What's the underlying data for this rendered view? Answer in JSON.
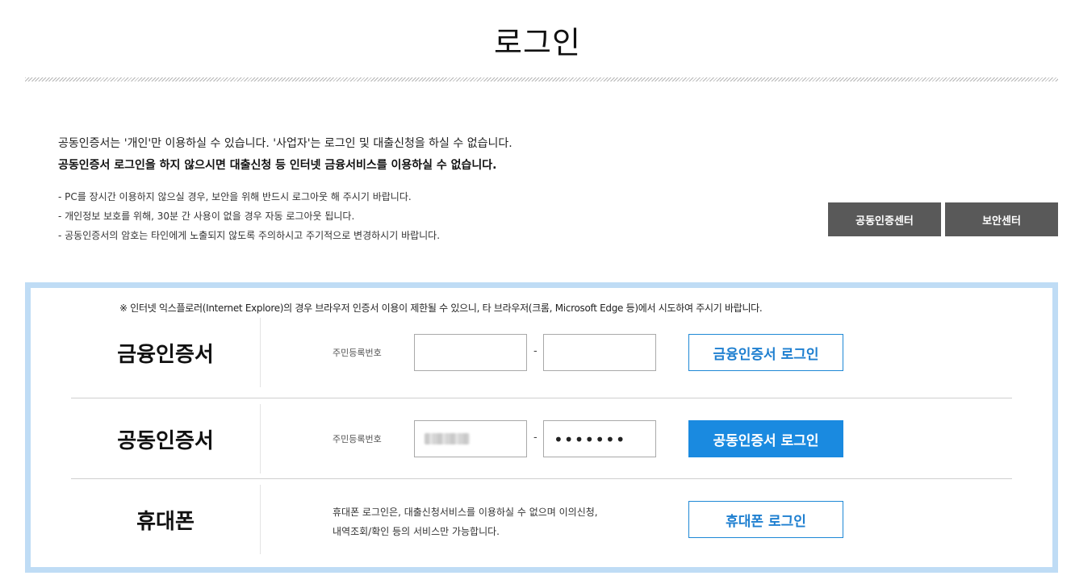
{
  "page": {
    "title": "로그인"
  },
  "notice": {
    "main": "공동인증서는 '개인'만 이용하실 수 있습니다. '사업자'는 로그인 및 대출신청을 하실 수 없습니다.",
    "bold": "공동인증서 로그인을 하지 않으시면 대출신청 등 인터넷 금융서비스를 이용하실 수 없습니다.",
    "items": [
      "- PC를 장시간 이용하지 않으실 경우, 보안을 위해 반드시 로그아웃 해 주시기 바랍니다.",
      "- 개인정보 보호를 위해, 30분 간 사용이 없을 경우 자동 로그아웃 됩니다.",
      "- 공동인증서의 암호는 타인에게 노출되지 않도록 주의하시고 주기적으로 변경하시기 바랍니다."
    ]
  },
  "buttons": {
    "cert_center": "공동인증센터",
    "security_center": "보안센터"
  },
  "login_box": {
    "ie_notice": "※ 인터넷 익스플로러(Internet Explore)의 경우 브라우저 인증서 이용이 제한될 수 있으니, 타 브라우저(크롬, Microsoft Edge 등)에서 시도하여 주시기 바랍니다.",
    "financial": {
      "label": "금융인증서",
      "field_label": "주민등록번호",
      "separator": "-",
      "front_value": "",
      "back_value": "",
      "button": "금융인증서 로그인"
    },
    "joint": {
      "label": "공동인증서",
      "field_label": "주민등록번호",
      "separator": "-",
      "back_value": "•••••••",
      "button": "공동인증서 로그인"
    },
    "phone": {
      "label": "휴대폰",
      "desc_line1": "휴대폰 로그인은, 대출신청서비스를 이용하실 수 없으며 이의신청,",
      "desc_line2": "내역조회/확인 등의 서비스만 가능합니다.",
      "button": "휴대폰 로그인"
    }
  },
  "colors": {
    "accent_blue": "#1a8ae0",
    "box_border": "#bfdcf5",
    "dark_button": "#595959"
  }
}
